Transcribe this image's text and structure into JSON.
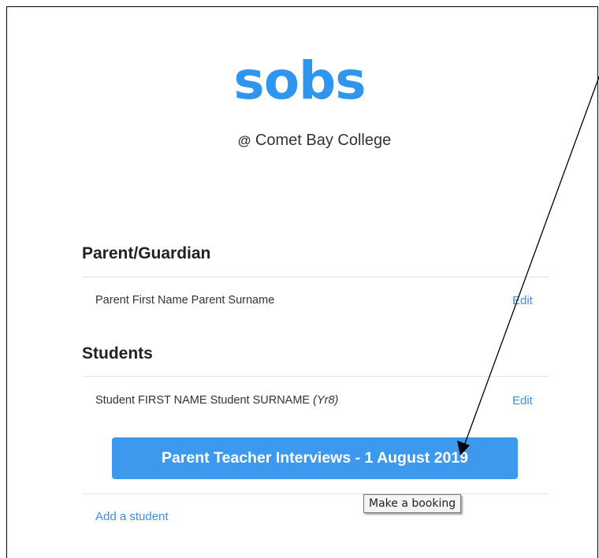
{
  "logo": {
    "text": "sobs",
    "color": "#2f96f0"
  },
  "school": {
    "at": "@",
    "name": "Comet Bay College"
  },
  "parent_section": {
    "title": "Parent/Guardian",
    "name": "Parent First Name Parent Surname",
    "edit_label": "Edit"
  },
  "students_section": {
    "title": "Students",
    "student_name": "Student FIRST NAME Student SURNAME",
    "student_year": "(Yr8)",
    "edit_label": "Edit"
  },
  "event_button": {
    "label": "Parent Teacher Interviews - 1 August 2019",
    "color": "#3c99ee"
  },
  "add_student": {
    "label": "Add a student"
  },
  "tooltip": {
    "text": "Make a booking"
  },
  "annotation": {
    "icon": "arrow-annotation"
  }
}
